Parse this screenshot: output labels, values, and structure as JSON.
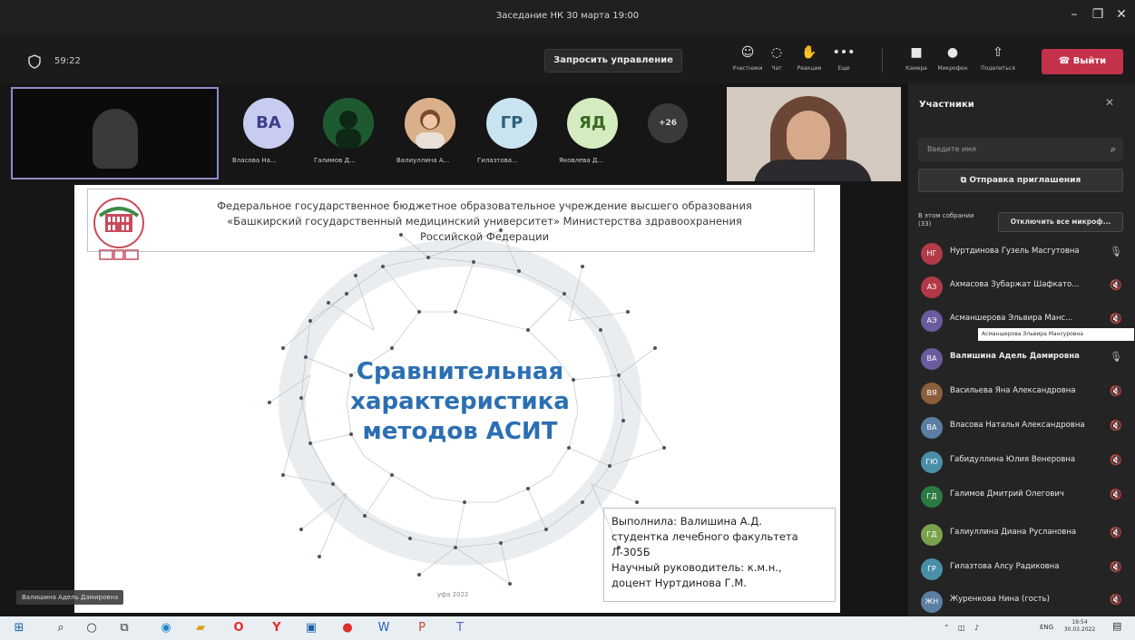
{
  "window": {
    "title": "Заседание НК 30 марта 19:00",
    "minimize_icon": "minimize-icon",
    "maximize_icon": "maximize-icon",
    "close_icon": "close-icon"
  },
  "toolbar": {
    "timer": "59:22",
    "request_control": "Запросить управление",
    "items": [
      {
        "icon": "participants-icon",
        "label": "Участники"
      },
      {
        "icon": "chat-icon",
        "label": "Чат"
      },
      {
        "icon": "reactions-icon",
        "label": "Реакции"
      },
      {
        "icon": "more-icon",
        "label": "Еще"
      },
      {
        "icon": "camera-icon",
        "label": "Камера"
      },
      {
        "icon": "microphone-icon",
        "label": "Микрофон"
      },
      {
        "icon": "share-icon",
        "label": "Поделиться"
      }
    ],
    "leave": "Выйти",
    "leave_color": "#c4314b"
  },
  "gallery": {
    "avatars": [
      {
        "initials": "ВА",
        "label": "Власова На...",
        "bg": "#c7ccf0",
        "fg": "#3b3f8c"
      },
      {
        "initials": "",
        "label": "Галимов Д...",
        "bg": "#2b7a42",
        "fg": "#ffffff"
      },
      {
        "initials": "",
        "label": "Валиуллина А...",
        "bg": "#c8a07a",
        "fg": "#ffffff"
      },
      {
        "initials": "ГР",
        "label": "Гилазтова...",
        "bg": "#c9e4f0",
        "fg": "#2d5f7a"
      },
      {
        "initials": "ЯД",
        "label": "Яковлева Д...",
        "bg": "#d4ecc0",
        "fg": "#3c6a25"
      }
    ],
    "more": "+26"
  },
  "slide": {
    "header_lines": [
      "Федеральное государственное бюджетное образовательное учреждение высшего образования",
      "«Башкирский государственный медицинский университет» Министерства здравоохранения",
      "Российской Федерации"
    ],
    "title_lines": [
      "Сравнительная",
      "характеристика",
      "методов АСИТ"
    ],
    "info_lines": [
      "Выполнила: Валишина А.Д.",
      "студентка лечебного факультета",
      "Л-305Б",
      "Научный руководитель: к.м.н.,",
      "доцент  Нуртдинова Г.М."
    ],
    "footer": "уфа 2022",
    "title_color": "#2b6fb3"
  },
  "self_name_tag": "Валишина Адель Дамировна",
  "panel": {
    "title": "Участники",
    "search_placeholder": "Введите имя",
    "invite": "Отправка приглашения",
    "in_meeting_line1": "В этом собрании",
    "in_meeting_line2": "(33)",
    "mute_all": "Отключить все микроф...",
    "participants": [
      {
        "name": "Нуртдинова Гузель Масгутовна",
        "initials": "НГ",
        "bg": "#b23a48",
        "mic": "mic-on-icon"
      },
      {
        "name": "Ахмасова Зубаржат Шафкато...",
        "initials": "АЗ",
        "bg": "#b23a48",
        "mic": "mic-off-icon"
      },
      {
        "name": "Асманшерова Эльвира Манс...",
        "initials": "АЭ",
        "bg": "#6a5b9e",
        "mic": "mic-off-icon"
      },
      {
        "name": "Валишина Адель Дамировна",
        "initials": "ВА",
        "bg": "#6a5b9e",
        "mic": "mic-on-icon"
      },
      {
        "name": "Васильева Яна Александровна",
        "initials": "ВЯ",
        "bg": "#8b5e3c",
        "mic": "mic-off-icon"
      },
      {
        "name": "Власова Наталья Александровна",
        "initials": "ВА",
        "bg": "#5b7ea4",
        "mic": "mic-off-icon"
      },
      {
        "name": "Габидуллина Юлия Венеровна",
        "initials": "ГЮ",
        "bg": "#4a8fa8",
        "mic": "mic-off-icon"
      },
      {
        "name": "Галимов Дмитрий Олегович",
        "initials": "ГД",
        "bg": "#2b7a42",
        "mic": "mic-off-icon"
      },
      {
        "name": "Галиуллина Диана Руслановна",
        "initials": "ГД",
        "bg": "#7aa24c",
        "mic": "mic-off-icon"
      },
      {
        "name": "Гилазтова Алсу Радиковна",
        "initials": "ГР",
        "bg": "#4a8fa8",
        "mic": "mic-off-icon"
      },
      {
        "name": "Журенкова Нина (гость)",
        "initials": "ЖН",
        "bg": "#5b7ea4",
        "mic": "mic-off-icon"
      }
    ],
    "tooltip": "Асманшерова Эльвира Мансуровна"
  },
  "taskbar": {
    "icons": [
      "windows-start-icon",
      "search-icon",
      "cortana-icon",
      "task-view-icon",
      "edge-icon",
      "file-explorer-icon",
      "opera-icon",
      "yandex-icon",
      "store-icon",
      "opera-gx-icon",
      "word-icon",
      "powerpoint-icon",
      "teams-icon"
    ],
    "lang": "ENG",
    "time": "19:54",
    "date": "30.03.2022"
  }
}
